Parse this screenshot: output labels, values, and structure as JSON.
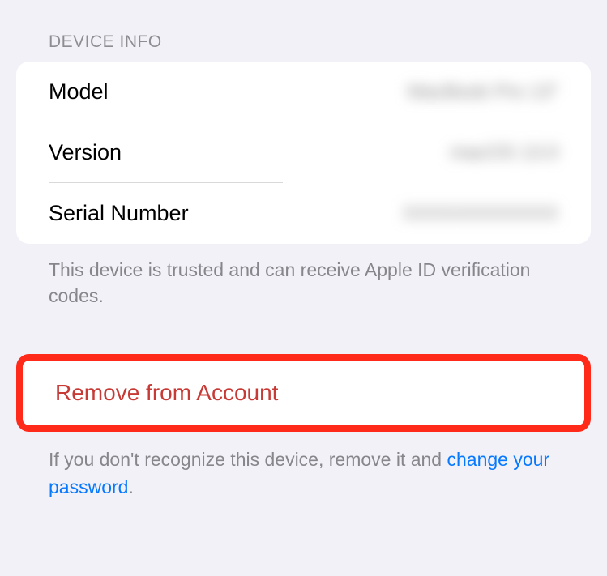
{
  "sectionHeader": "DEVICE INFO",
  "deviceInfo": {
    "model": {
      "label": "Model",
      "value": "MacBook Pro 13\""
    },
    "version": {
      "label": "Version",
      "value": "macOS 13.0"
    },
    "serial": {
      "label": "Serial Number",
      "value": "XXXXXXXXXXXX"
    }
  },
  "trustedFooter": "This device is trusted and can receive Apple ID verification codes.",
  "removeAction": "Remove from Account",
  "recognizePrefix": "If you don't recognize this device, remove it and ",
  "changePasswordLink": "change your password",
  "period": "."
}
